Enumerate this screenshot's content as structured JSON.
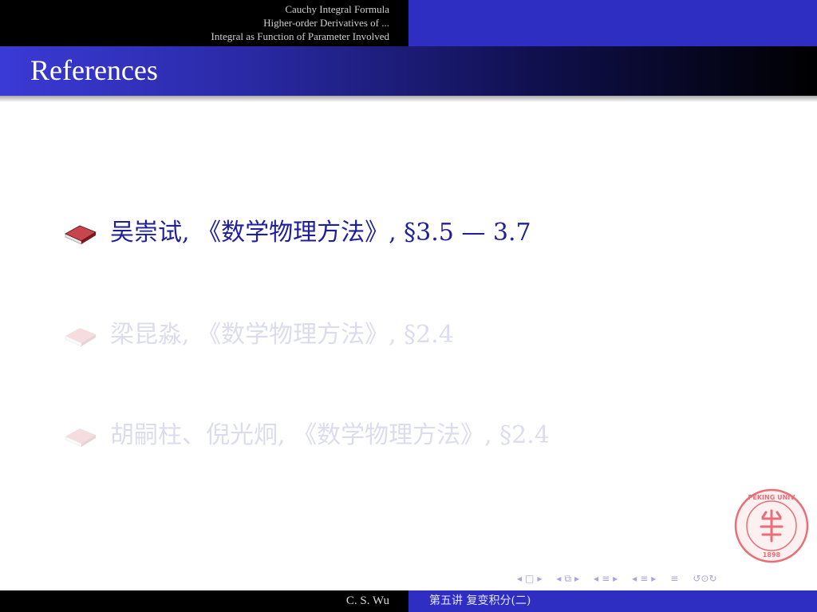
{
  "header": {
    "sections": [
      "Cauchy Integral Formula",
      "Higher-order Derivatives of ...",
      "Integral as Function of Parameter Involved"
    ]
  },
  "frame": {
    "title": "References"
  },
  "references": [
    {
      "icon": "book-icon",
      "text": "吴崇试, 《数学物理方法》, §3.5 — 3.7",
      "state": "active"
    },
    {
      "icon": "book-icon",
      "text": "梁昆淼, 《数学物理方法》, §2.4",
      "state": "faded"
    },
    {
      "icon": "book-icon",
      "text": "胡嗣柱、倪光炯, 《数学物理方法》, §2.4",
      "state": "faded"
    }
  ],
  "seal": {
    "ring_text": "PEKING UNIVERSITY",
    "year": "1898",
    "color": "#e86f78"
  },
  "navigation": {
    "icons": [
      "frame-prev-icon",
      "frame-next-icon",
      "subsection-prev-icon",
      "subsection-next-icon",
      "section-prev-icon",
      "section-next-icon",
      "align-icon",
      "search-icon"
    ]
  },
  "footer": {
    "author": "C. S. Wu",
    "lecture": "第五讲  复变积分(二)"
  },
  "colors": {
    "header_left": "#000000",
    "header_right": "#2e2ec2",
    "text_active": "#1f1f9e",
    "text_faded": "#dcdcef",
    "book": "#a0242c"
  }
}
